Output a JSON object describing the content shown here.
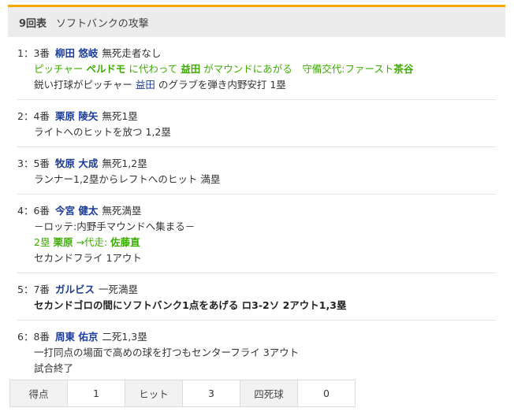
{
  "header": {
    "inning": "9回表",
    "title": "ソフトバンクの攻撃"
  },
  "plays": [
    {
      "no": "1：3番",
      "batter": "柳田 悠岐",
      "situation": "無死走者なし",
      "sub1": {
        "a": "ピッチャー",
        "b": "ペルドモ",
        "c": "に代わって",
        "d": "益田",
        "e": "がマウンドにあがる　守備交代:ファースト",
        "f": "茶谷"
      },
      "sub2": {
        "a": "鋭い打球がピッチャー",
        "b": "益田",
        "c": "のグラブを弾き内野安打 1塁"
      }
    },
    {
      "no": "2：4番",
      "batter": "栗原 陵矢",
      "situation": "無死1塁",
      "result": "ライトへのヒットを放つ 1,2塁"
    },
    {
      "no": "3：5番",
      "batter": "牧原 大成",
      "situation": "無死1,2塁",
      "result": "ランナー1,2塁からレフトへのヒット 満塁"
    },
    {
      "no": "4：6番",
      "batter": "今宮 健太",
      "situation": "無死満塁",
      "note": "－ロッテ:内野手マウンドへ集まる－",
      "pinch": {
        "a": "2塁",
        "b": "栗原",
        "c": "→代走:",
        "d": "佐藤直"
      },
      "result": "セカンドフライ 1アウト"
    },
    {
      "no": "5：7番",
      "batter": "ガルビス",
      "situation": "一死満塁",
      "result": "セカンドゴロの間にソフトバンク1点をあげる ロ3-2ソ 2アウト1,3塁"
    },
    {
      "no": "6：8番",
      "batter": "周東 佑京",
      "situation": "二死1,3塁",
      "result": "一打同点の場面で高めの球を打つもセンターフライ 3アウト",
      "end": "試合終了"
    }
  ],
  "stats": {
    "runs_label": "得点",
    "runs": "1",
    "hits_label": "ヒット",
    "hits": "3",
    "walks_label": "四死球",
    "walks": "0"
  },
  "colors": {
    "accent": "#f5a800",
    "player": "#1a3b99",
    "green": "#3cac00"
  }
}
